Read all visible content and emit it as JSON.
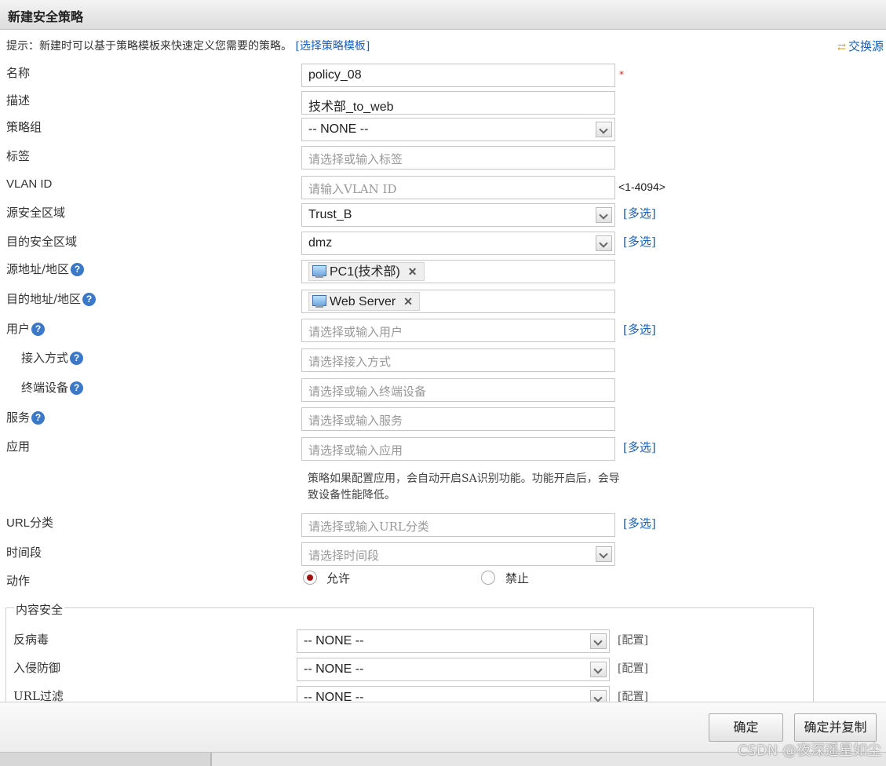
{
  "dialog": {
    "title": "新建安全策略"
  },
  "hint": {
    "text": "提示：新建时可以基于策略模板来快速定义您需要的策略。",
    "link": "[选择策略模板]"
  },
  "swap_label": "交换源",
  "form": {
    "name": {
      "label": "名称",
      "value": "policy_08"
    },
    "description": {
      "label": "描述",
      "value": "技术部_to_web"
    },
    "policy_group": {
      "label": "策略组",
      "value": "-- NONE --"
    },
    "tag": {
      "label": "标签",
      "placeholder": "请选择或输入标签"
    },
    "vlan": {
      "label": "VLAN ID",
      "placeholder": "请输入VLAN ID",
      "range": "<1-4094>"
    },
    "src_zone": {
      "label": "源安全区域",
      "value": "Trust_B",
      "multi": "[多选]"
    },
    "dst_zone": {
      "label": "目的安全区域",
      "value": "dmz",
      "multi": "[多选]"
    },
    "src_addr": {
      "label": "源地址/地区",
      "tag": "PC1(技术部)"
    },
    "dst_addr": {
      "label": "目的地址/地区",
      "tag": "Web Server"
    },
    "user": {
      "label": "用户",
      "placeholder": "请选择或输入用户",
      "multi": "[多选]"
    },
    "access_mode": {
      "label": "接入方式",
      "placeholder": "请选择接入方式"
    },
    "terminal": {
      "label": "终端设备",
      "placeholder": "请选择或输入终端设备"
    },
    "service": {
      "label": "服务",
      "placeholder": "请选择或输入服务"
    },
    "application": {
      "label": "应用",
      "placeholder": "请选择或输入应用",
      "multi": "[多选]",
      "note": "策略如果配置应用，会自动开启SA识别功能。功能开启后，会导致设备性能降低。"
    },
    "url_category": {
      "label": "URL分类",
      "placeholder": "请选择或输入URL分类",
      "multi": "[多选]"
    },
    "schedule": {
      "label": "时间段",
      "placeholder": "请选择时间段"
    },
    "action": {
      "label": "动作",
      "permit": "允许",
      "deny": "禁止",
      "selected": "允许"
    }
  },
  "content_security": {
    "legend": "内容安全",
    "antivirus": {
      "label": "反病毒",
      "value": "-- NONE --",
      "config": "[配置]"
    },
    "ips": {
      "label": "入侵防御",
      "value": "-- NONE --",
      "config": "[配置]"
    },
    "url_filter": {
      "label": "URL过滤",
      "value": "-- NONE --",
      "config": "[配置]"
    }
  },
  "footer": {
    "ok": "确定",
    "ok_copy": "确定并复制"
  },
  "watermark": "CSDN @夜深遥星如尘"
}
